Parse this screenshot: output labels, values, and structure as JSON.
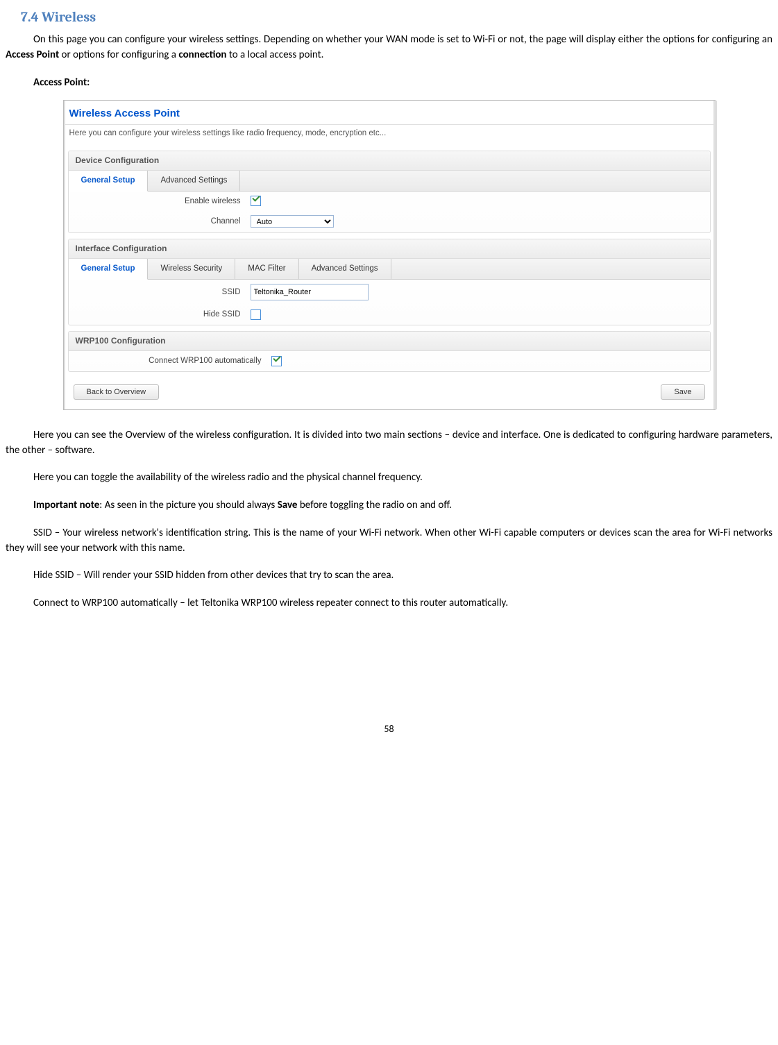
{
  "heading": "7.4  Wireless",
  "intro_html": "On this page you can configure your wireless settings. Depending on whether your WAN mode is set to Wi-Fi or not, the page will display either the options for configuring an <strong>Access Point</strong> or options for configuring a <strong>connection</strong> to a local access point.",
  "sublabel": "Access Point:",
  "panel": {
    "title": "Wireless Access Point",
    "subtitle": "Here you can configure your wireless settings like radio frequency, mode, encryption etc...",
    "device_section": "Device Configuration",
    "device_tabs": [
      "General Setup",
      "Advanced Settings"
    ],
    "enable_label": "Enable wireless",
    "enable_checked": true,
    "channel_label": "Channel",
    "channel_value": "Auto",
    "iface_section": "Interface Configuration",
    "iface_tabs": [
      "General Setup",
      "Wireless Security",
      "MAC Filter",
      "Advanced Settings"
    ],
    "ssid_label": "SSID",
    "ssid_value": "Teltonika_Router",
    "hide_label": "Hide SSID",
    "hide_checked": false,
    "wrp_section": "WRP100 Configuration",
    "wrp_label": "Connect WRP100 automatically",
    "wrp_checked": true,
    "back_btn": "Back to Overview",
    "save_btn": "Save"
  },
  "paras": {
    "p1": "Here you can see the Overview of the wireless configuration. It is divided into two main sections – device and interface. One is dedicated to configuring hardware parameters, the other – software.",
    "p2": "Here you can toggle the availability of the wireless radio and the physical channel frequency.",
    "p3_html": "<strong>Important note</strong>: As seen in the picture you should always <strong>Save</strong> before toggling the radio on and off.",
    "p4": "SSID – Your wireless network's identification string. This is the name of your Wi-Fi network. When other Wi-Fi capable computers or devices scan the area for Wi-Fi networks they will see your network with this name.",
    "p5": "Hide SSID – Will render your SSID hidden from other devices that try to scan the area.",
    "p6": "Connect to WRP100 automatically – let Teltonika WRP100 wireless repeater connect to this router automatically."
  },
  "pagenum": "58"
}
